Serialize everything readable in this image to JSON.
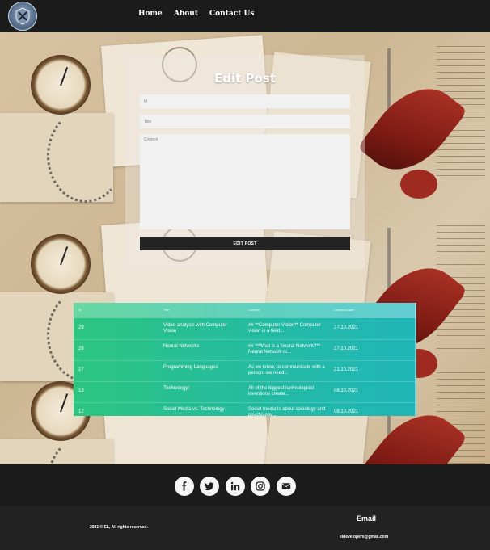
{
  "navbar": {
    "logo_icon": "shield-crossed-arrows-logo",
    "links": [
      "Home",
      "About",
      "Contact Us"
    ]
  },
  "edit_form": {
    "title": "Edit Post",
    "id_placeholder": "Id",
    "title_placeholder": "Title",
    "content_placeholder": "Content",
    "submit_label": "EDIT POST"
  },
  "posts_table": {
    "headers": [
      "Id",
      "Title",
      "Content",
      "Creation Date"
    ],
    "rows": [
      {
        "id": "29",
        "title": "Video analysis with Computer Vision",
        "content": "## **Computer Vision** Computer vision is a field...",
        "date": "27.10.2021"
      },
      {
        "id": "28",
        "title": "Neural Networks",
        "content": "## **What is a Neural Network?** Neural Network or...",
        "date": "27.10.2021"
      },
      {
        "id": "27",
        "title": "Programming Languages",
        "content": "As we know, to communicate with a person, we need...",
        "date": "21.10.2021"
      },
      {
        "id": "13",
        "title": "Technology!",
        "content": "All of the biggest technological inventions create...",
        "date": "08.10.2021"
      },
      {
        "id": "12",
        "title": "Social Media vs. Technology",
        "content": "Social media is about sociology and psychology...",
        "date": "08.10.2021"
      }
    ]
  },
  "social": {
    "icons": [
      "facebook-icon",
      "twitter-icon",
      "linkedin-icon",
      "instagram-icon",
      "email-icon"
    ]
  },
  "footer": {
    "copyright": "2021 © EL, All rights reserved.",
    "email_heading": "Email",
    "email_value": "eldevelopers@gmail.com"
  },
  "colors": {
    "navbar_bg": "#1b1b1b",
    "table_gradient_start": "#2dc57f",
    "table_gradient_end": "#20b5b8",
    "button_bg": "#242424"
  }
}
